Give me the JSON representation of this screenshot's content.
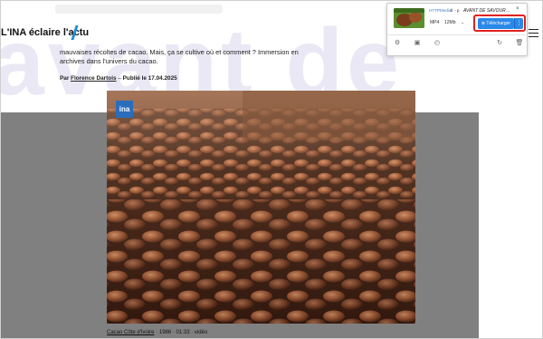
{
  "header": {
    "site_title": "L'INA éclaire l'actu"
  },
  "background": {
    "watermark_text": "avant de"
  },
  "article": {
    "intro": "mauvaises récoltes de cacao. Mais, ça se cultive où et comment ? Immersion en archives dans l'univers du cacao.",
    "byline": {
      "prefix": "Par",
      "author": "Florence Dartois",
      "separator": "–",
      "published_label": "Publié le",
      "published_date": "17.04.2025"
    }
  },
  "video": {
    "logo": "ina",
    "caption": {
      "title": "Cacao Côte d'Ivoire",
      "details": "· 1986 · 01:33 · vidéo"
    }
  },
  "downloader_popup": {
    "source": "HTTPMedia",
    "language": "fr - p",
    "title": "AVANT DE SAVOUR…",
    "format": "MP4",
    "size": "12Mb",
    "download_label": "Télécharger",
    "close_glyph": "×",
    "colors": {
      "accent": "#2a88e8",
      "highlight": "#e02020"
    },
    "icons": [
      "settings-icon",
      "panel-icon",
      "history-icon",
      "refresh-icon",
      "trash-icon"
    ]
  },
  "colors": {
    "slash": "#1e8fd6",
    "gray_overlay": "#808080",
    "ina_logo": "#2b6dbb"
  }
}
